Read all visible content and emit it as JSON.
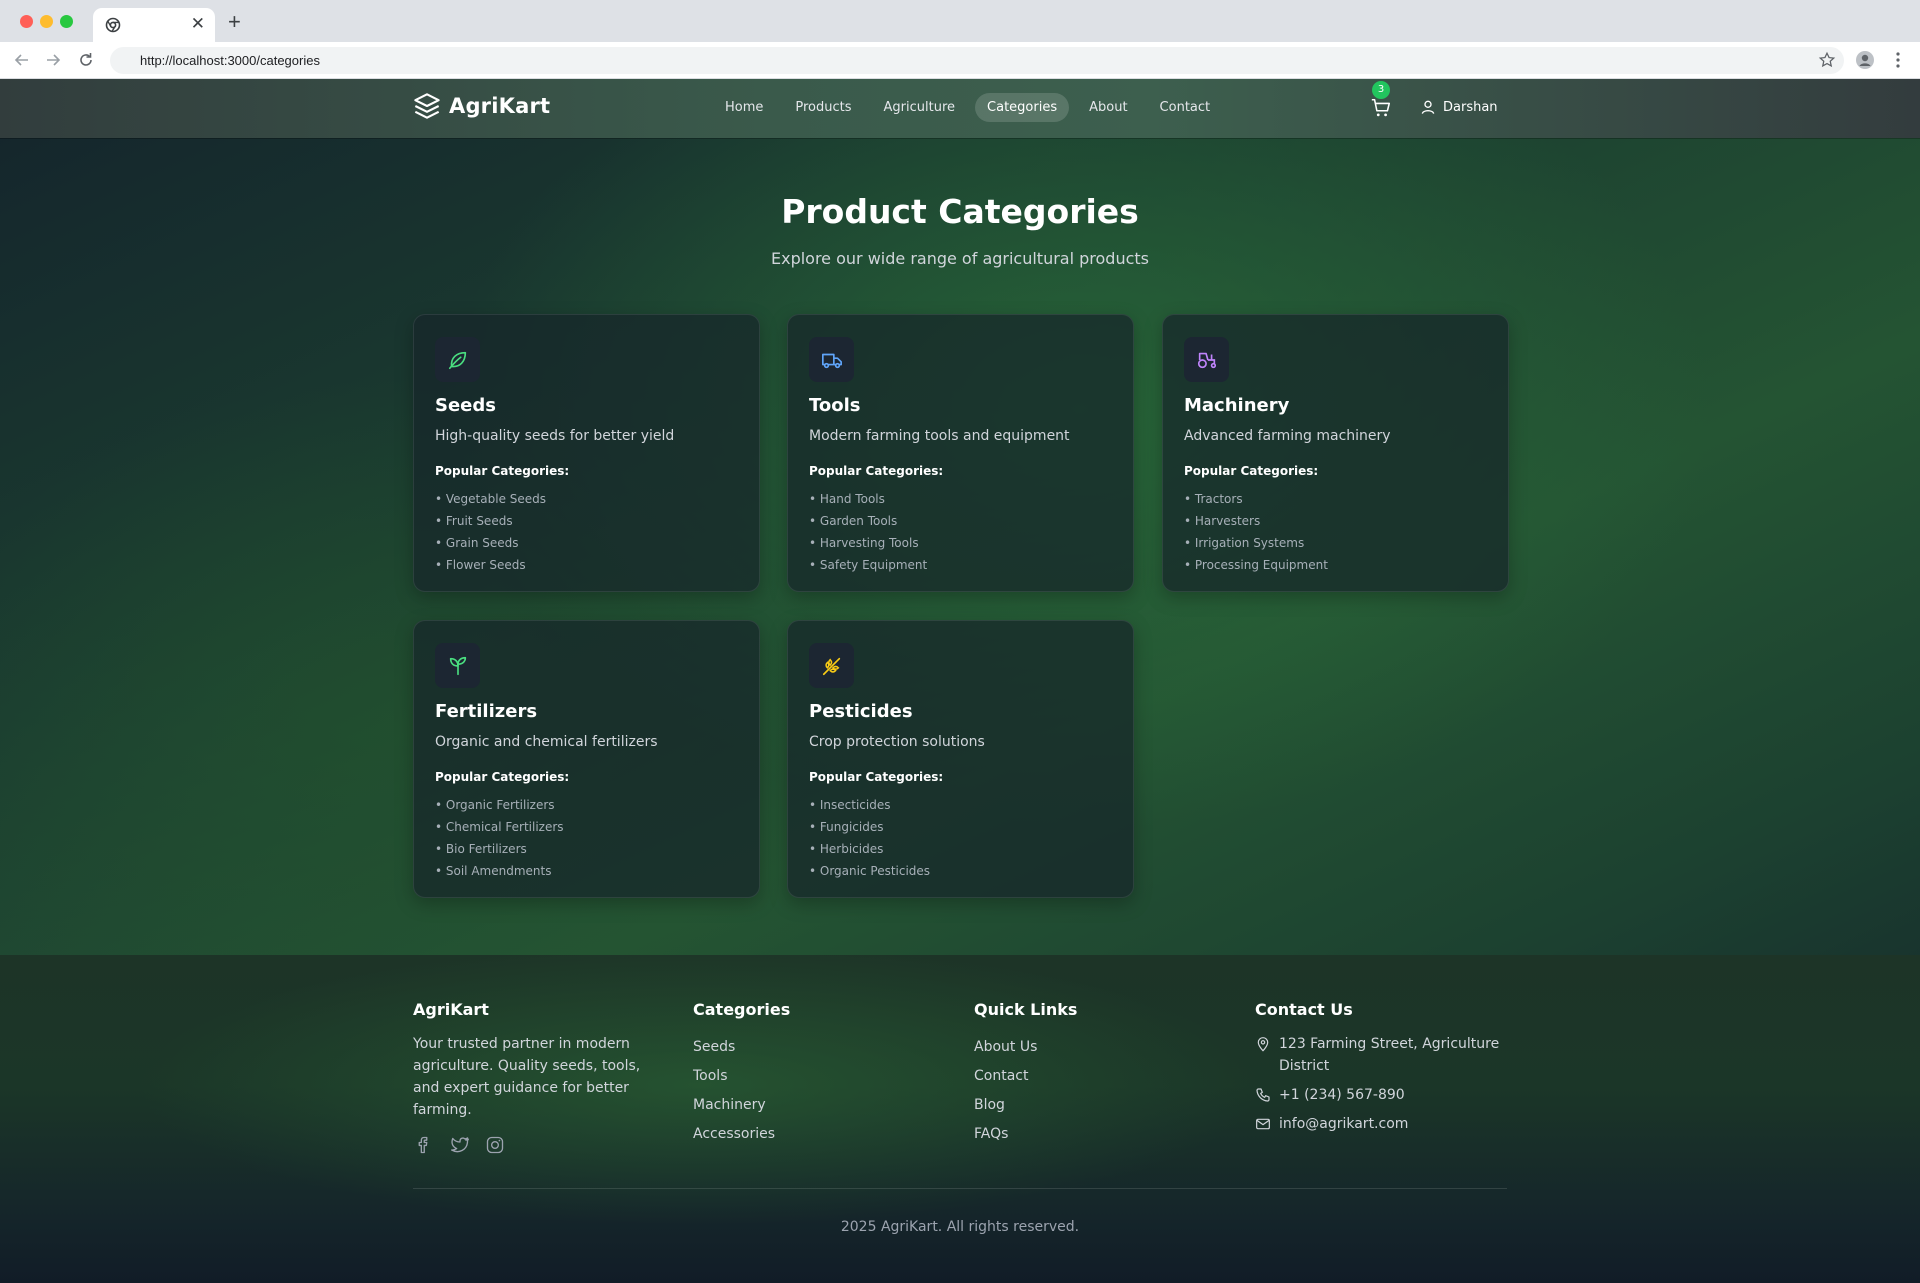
{
  "browser": {
    "url": "http://localhost:3000/categories",
    "close_glyph": "✕",
    "new_tab_glyph": "+"
  },
  "navbar": {
    "brand": "AgriKart",
    "links": [
      "Home",
      "Products",
      "Agriculture",
      "Categories",
      "About",
      "Contact"
    ],
    "active": "Categories",
    "cart_count": "3",
    "user_name": "Darshan"
  },
  "hero": {
    "title": "Product Categories",
    "subtitle": "Explore our wide range of agricultural products"
  },
  "popular_label": "Popular Categories:",
  "categories": [
    {
      "title": "Seeds",
      "icon": "leaf-icon",
      "icon_color": "#4ade80",
      "description": "High-quality seeds for better yield",
      "items": [
        "• Vegetable Seeds",
        "• Fruit Seeds",
        "• Grain Seeds",
        "• Flower Seeds"
      ]
    },
    {
      "title": "Tools",
      "icon": "truck-icon",
      "icon_color": "#60a5fa",
      "description": "Modern farming tools and equipment",
      "items": [
        "• Hand Tools",
        "• Garden Tools",
        "• Harvesting Tools",
        "• Safety Equipment"
      ]
    },
    {
      "title": "Machinery",
      "icon": "tractor-icon",
      "icon_color": "#c084fc",
      "description": "Advanced farming machinery",
      "items": [
        "• Tractors",
        "• Harvesters",
        "• Irrigation Systems",
        "• Processing Equipment"
      ]
    },
    {
      "title": "Fertilizers",
      "icon": "sprout-icon",
      "icon_color": "#4ade80",
      "description": "Organic and chemical fertilizers",
      "items": [
        "• Organic Fertilizers",
        "• Chemical Fertilizers",
        "• Bio Fertilizers",
        "• Soil Amendments"
      ]
    },
    {
      "title": "Pesticides",
      "icon": "wheat-icon",
      "icon_color": "#facc15",
      "description": "Crop protection solutions",
      "items": [
        "• Insecticides",
        "• Fungicides",
        "• Herbicides",
        "• Organic Pesticides"
      ]
    }
  ],
  "footer": {
    "brand": {
      "title": "AgriKart",
      "text": "Your trusted partner in modern agriculture. Quality seeds, tools, and expert guidance for better farming."
    },
    "categories": {
      "title": "Categories",
      "links": [
        "Seeds",
        "Tools",
        "Machinery",
        "Accessories"
      ]
    },
    "quick_links": {
      "title": "Quick Links",
      "links": [
        "About Us",
        "Contact",
        "Blog",
        "FAQs"
      ]
    },
    "contact": {
      "title": "Contact Us",
      "address": "123 Farming Street, Agriculture District",
      "phone": "+1 (234) 567-890",
      "email": "info@agrikart.com"
    },
    "copyright": "2025 AgriKart. All rights reserved."
  }
}
